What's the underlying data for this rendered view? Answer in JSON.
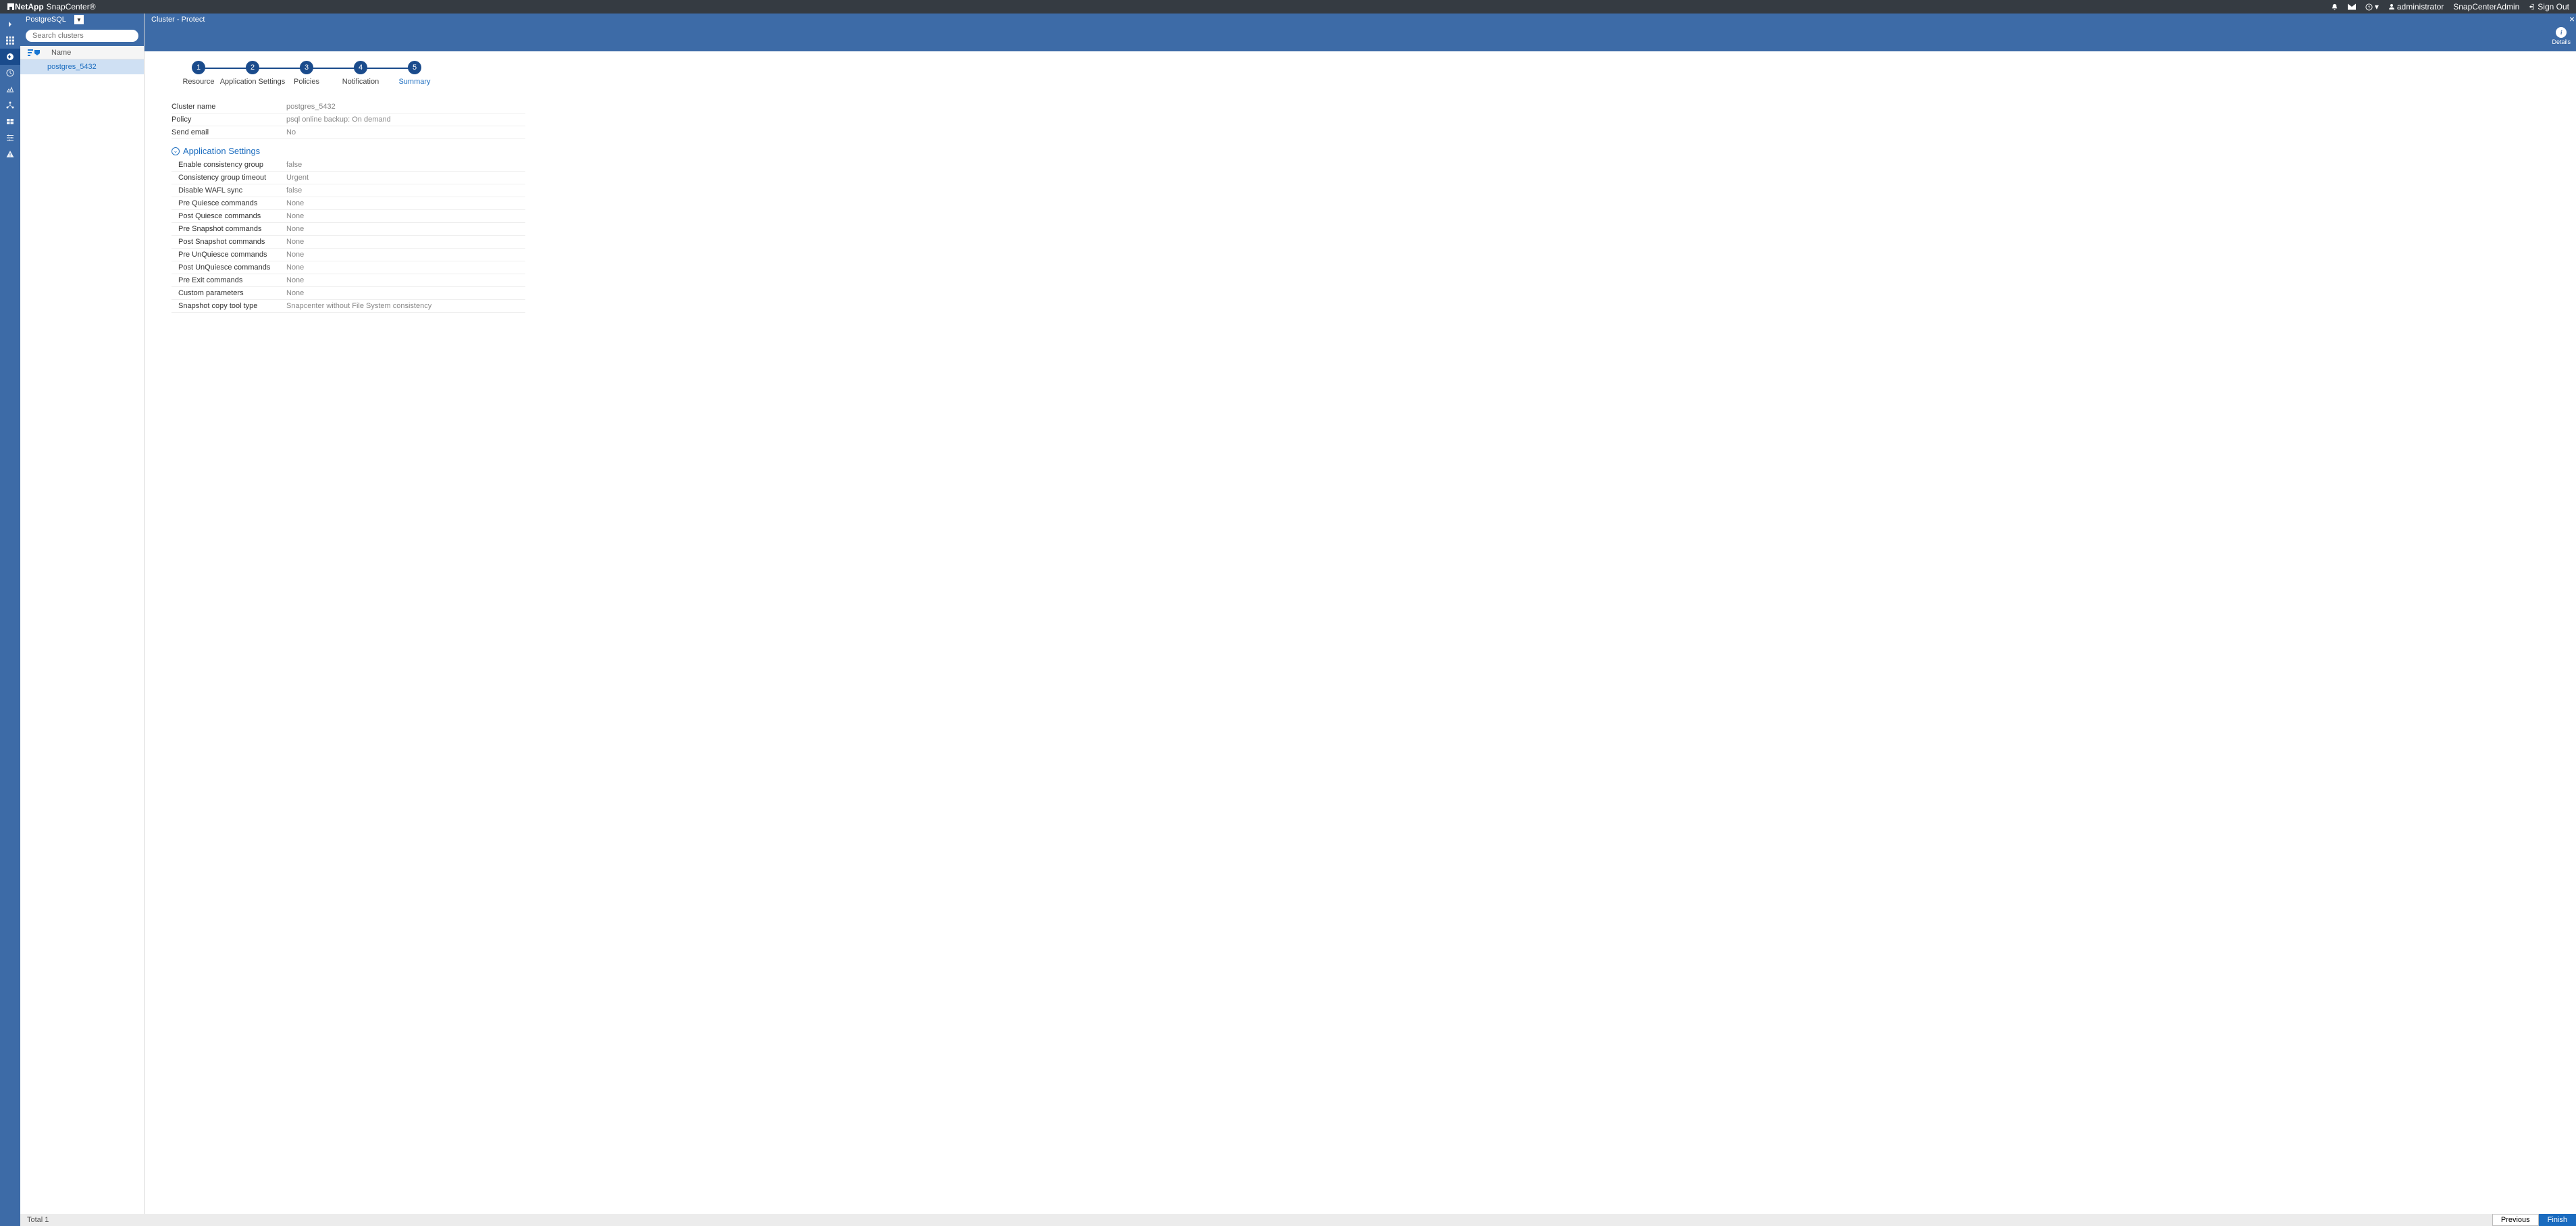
{
  "header": {
    "brand": "NetApp",
    "product": "SnapCenter®",
    "user": "administrator",
    "role": "SnapCenterAdmin",
    "signout": "Sign Out"
  },
  "panel": {
    "tab": "PostgreSQL",
    "search_ph": "Search clusters",
    "col": "Name",
    "rows": [
      "postgres_5432"
    ]
  },
  "crumb": "Cluster - Protect",
  "details_label": "Details",
  "steps": [
    {
      "n": "1",
      "label": "Resource"
    },
    {
      "n": "2",
      "label": "Application Settings"
    },
    {
      "n": "3",
      "label": "Policies"
    },
    {
      "n": "4",
      "label": "Notification"
    },
    {
      "n": "5",
      "label": "Summary"
    }
  ],
  "summary_top": [
    {
      "k": "Cluster name",
      "v": "postgres_5432"
    },
    {
      "k": "Policy",
      "v": "psql online backup: On demand"
    },
    {
      "k": "Send email",
      "v": "No"
    }
  ],
  "app_settings_title": "Application Settings",
  "app_settings": [
    {
      "k": "Enable consistency group",
      "v": "false"
    },
    {
      "k": "Consistency group timeout",
      "v": "Urgent"
    },
    {
      "k": "Disable WAFL sync",
      "v": "false"
    },
    {
      "k": "Pre Quiesce commands",
      "v": "None"
    },
    {
      "k": "Post Quiesce commands",
      "v": "None"
    },
    {
      "k": "Pre Snapshot commands",
      "v": "None"
    },
    {
      "k": "Post Snapshot commands",
      "v": "None"
    },
    {
      "k": "Pre UnQuiesce commands",
      "v": "None"
    },
    {
      "k": "Post UnQuiesce commands",
      "v": "None"
    },
    {
      "k": "Pre Exit commands",
      "v": "None"
    },
    {
      "k": "Custom parameters",
      "v": "None"
    },
    {
      "k": "Snapshot copy tool type",
      "v": "Snapcenter without File System consistency"
    }
  ],
  "status": "Total 1",
  "buttons": {
    "prev": "Previous",
    "finish": "Finish"
  }
}
